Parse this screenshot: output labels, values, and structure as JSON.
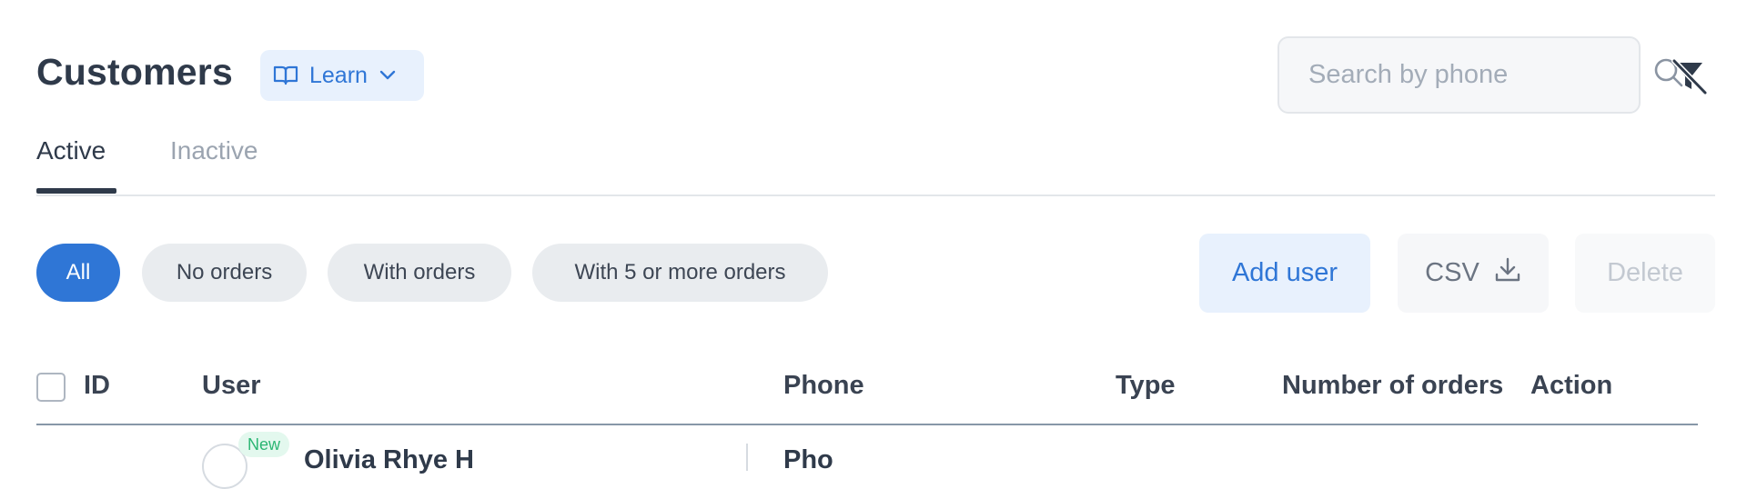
{
  "header": {
    "title": "Customers",
    "learn_label": "Learn",
    "search_placeholder": "Search by phone"
  },
  "tabs": [
    {
      "label": "Active",
      "active": true
    },
    {
      "label": "Inactive",
      "active": false
    }
  ],
  "filters": [
    {
      "label": "All",
      "active": true
    },
    {
      "label": "No orders",
      "active": false
    },
    {
      "label": "With orders",
      "active": false
    },
    {
      "label": "With 5 or more orders",
      "active": false
    }
  ],
  "actions": {
    "add_user": "Add user",
    "csv": "CSV",
    "delete": "Delete"
  },
  "table": {
    "columns": [
      "ID",
      "User",
      "Phone",
      "Type",
      "Number of orders",
      "Action"
    ],
    "rows": [
      {
        "badge": "New",
        "user": "Olivia Rhye H",
        "phone": "Pho"
      }
    ]
  },
  "colors": {
    "accent": "#2f76d6",
    "accent_light": "#e8f1fd",
    "chip_bg": "#e9ecef",
    "new_badge": "#2bb673"
  },
  "icons": {
    "learn": "book-icon",
    "learn_chevron": "chevron-down-icon",
    "search": "search-icon",
    "filter_off": "filter-off-icon",
    "csv": "download-icon"
  }
}
